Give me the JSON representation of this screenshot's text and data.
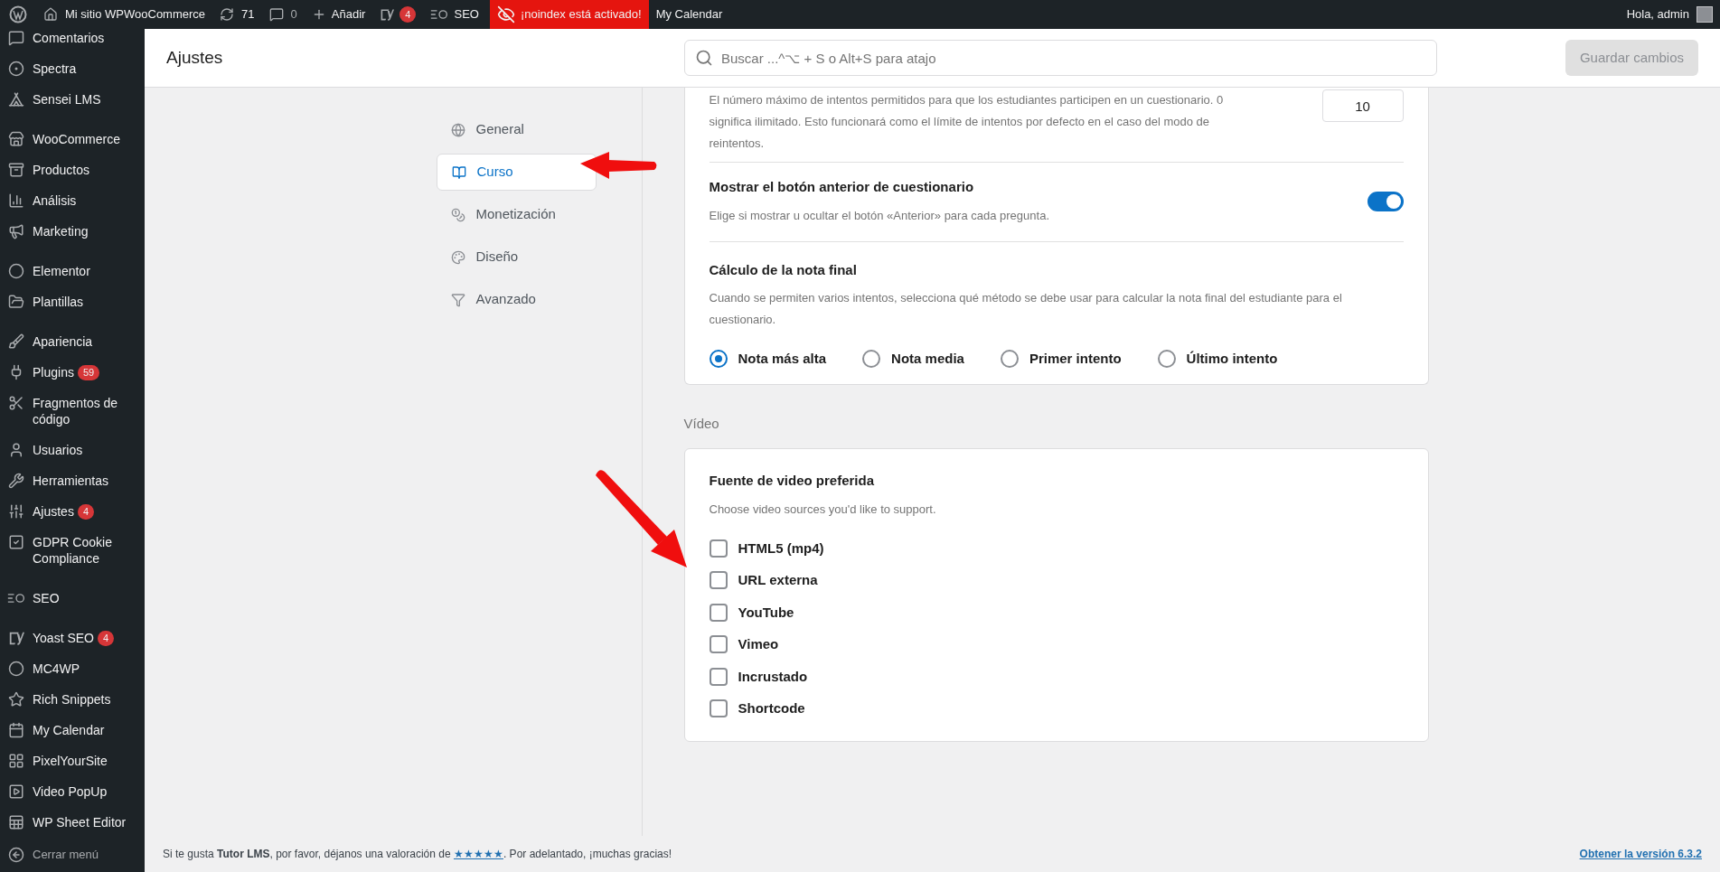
{
  "admin_bar": {
    "site": "Mi sitio WPWooCommerce",
    "updates": "71",
    "comments": "0",
    "add": "Añadir",
    "yoast_count": "4",
    "seo": "SEO",
    "noindex": "¡noindex está activado!",
    "calendar": "My Calendar",
    "greeting": "Hola, admin"
  },
  "sidebar": {
    "groups": [
      {
        "items": [
          {
            "label": "Comentarios"
          },
          {
            "label": "Spectra"
          },
          {
            "label": "Sensei LMS"
          }
        ]
      },
      {
        "items": [
          {
            "label": "WooCommerce"
          },
          {
            "label": "Productos"
          },
          {
            "label": "Análisis"
          },
          {
            "label": "Marketing"
          }
        ]
      },
      {
        "items": [
          {
            "label": "Elementor"
          },
          {
            "label": "Plantillas"
          }
        ]
      },
      {
        "items": [
          {
            "label": "Apariencia"
          },
          {
            "label": "Plugins",
            "badge": "59"
          },
          {
            "label": "Fragmentos de código"
          },
          {
            "label": "Usuarios"
          },
          {
            "label": "Herramientas"
          },
          {
            "label": "Ajustes",
            "badge": "4"
          },
          {
            "label": "GDPR Cookie Compliance"
          }
        ]
      },
      {
        "items": [
          {
            "label": "SEO"
          }
        ]
      },
      {
        "items": [
          {
            "label": "Yoast SEO",
            "badge": "4"
          },
          {
            "label": "MC4WP"
          },
          {
            "label": "Rich Snippets"
          },
          {
            "label": "My Calendar"
          },
          {
            "label": "PixelYourSite"
          },
          {
            "label": "Video PopUp"
          },
          {
            "label": "WP Sheet Editor"
          }
        ]
      }
    ],
    "collapse": "Cerrar menú"
  },
  "header": {
    "title": "Ajustes",
    "search": {
      "placeholder": "Buscar ...^⌥ + S o Alt+S para atajo"
    },
    "save": {
      "label": "Guardar cambios",
      "disabled": true
    }
  },
  "settings_nav": [
    {
      "label": "General",
      "selected": false
    },
    {
      "label": "Curso",
      "selected": true
    },
    {
      "label": "Monetización",
      "selected": false
    },
    {
      "label": "Diseño",
      "selected": false
    },
    {
      "label": "Avanzado",
      "selected": false
    }
  ],
  "sections": [
    {
      "rows": [
        {
          "kind": "number",
          "description": "El número máximo de intentos permitidos para que los estudiantes participen en un cuestionario. 0 significa ilimitado. Esto funcionará como el límite de intentos por defecto en el caso del modo de reintentos.",
          "value": "10"
        },
        {
          "kind": "toggle",
          "title": "Mostrar el botón anterior de cuestionario",
          "description": "Elige si mostrar u ocultar el botón «Anterior» para cada pregunta.",
          "on": true
        },
        {
          "kind": "radio",
          "title": "Cálculo de la nota final",
          "description": "Cuando se permiten varios intentos, selecciona qué método se debe usar para calcular la nota final del estudiante para el cuestionario.",
          "options": [
            {
              "label": "Nota más alta",
              "selected": true
            },
            {
              "label": "Nota media",
              "selected": false
            },
            {
              "label": "Primer intento",
              "selected": false
            },
            {
              "label": "Último intento",
              "selected": false
            }
          ]
        }
      ]
    },
    {
      "heading": "Vídeo",
      "rows": [
        {
          "kind": "checkboxes",
          "title": "Fuente de video preferida",
          "description": "Choose video sources you'd like to support.",
          "options": [
            {
              "label": "HTML5 (mp4)",
              "checked": false
            },
            {
              "label": "URL externa",
              "checked": false
            },
            {
              "label": "YouTube",
              "checked": false
            },
            {
              "label": "Vimeo",
              "checked": false
            },
            {
              "label": "Incrustado",
              "checked": false
            },
            {
              "label": "Shortcode",
              "checked": false
            }
          ]
        }
      ]
    }
  ],
  "footer": {
    "note_start": "Si te gusta **Tutor LMS**, por favor, déjanos una valoración de ",
    "rating_link": "★★★★★",
    "note_end": ". Por adelantado, ¡muchas gracias!",
    "version_link": "Obtener la versión 6.3.2"
  }
}
